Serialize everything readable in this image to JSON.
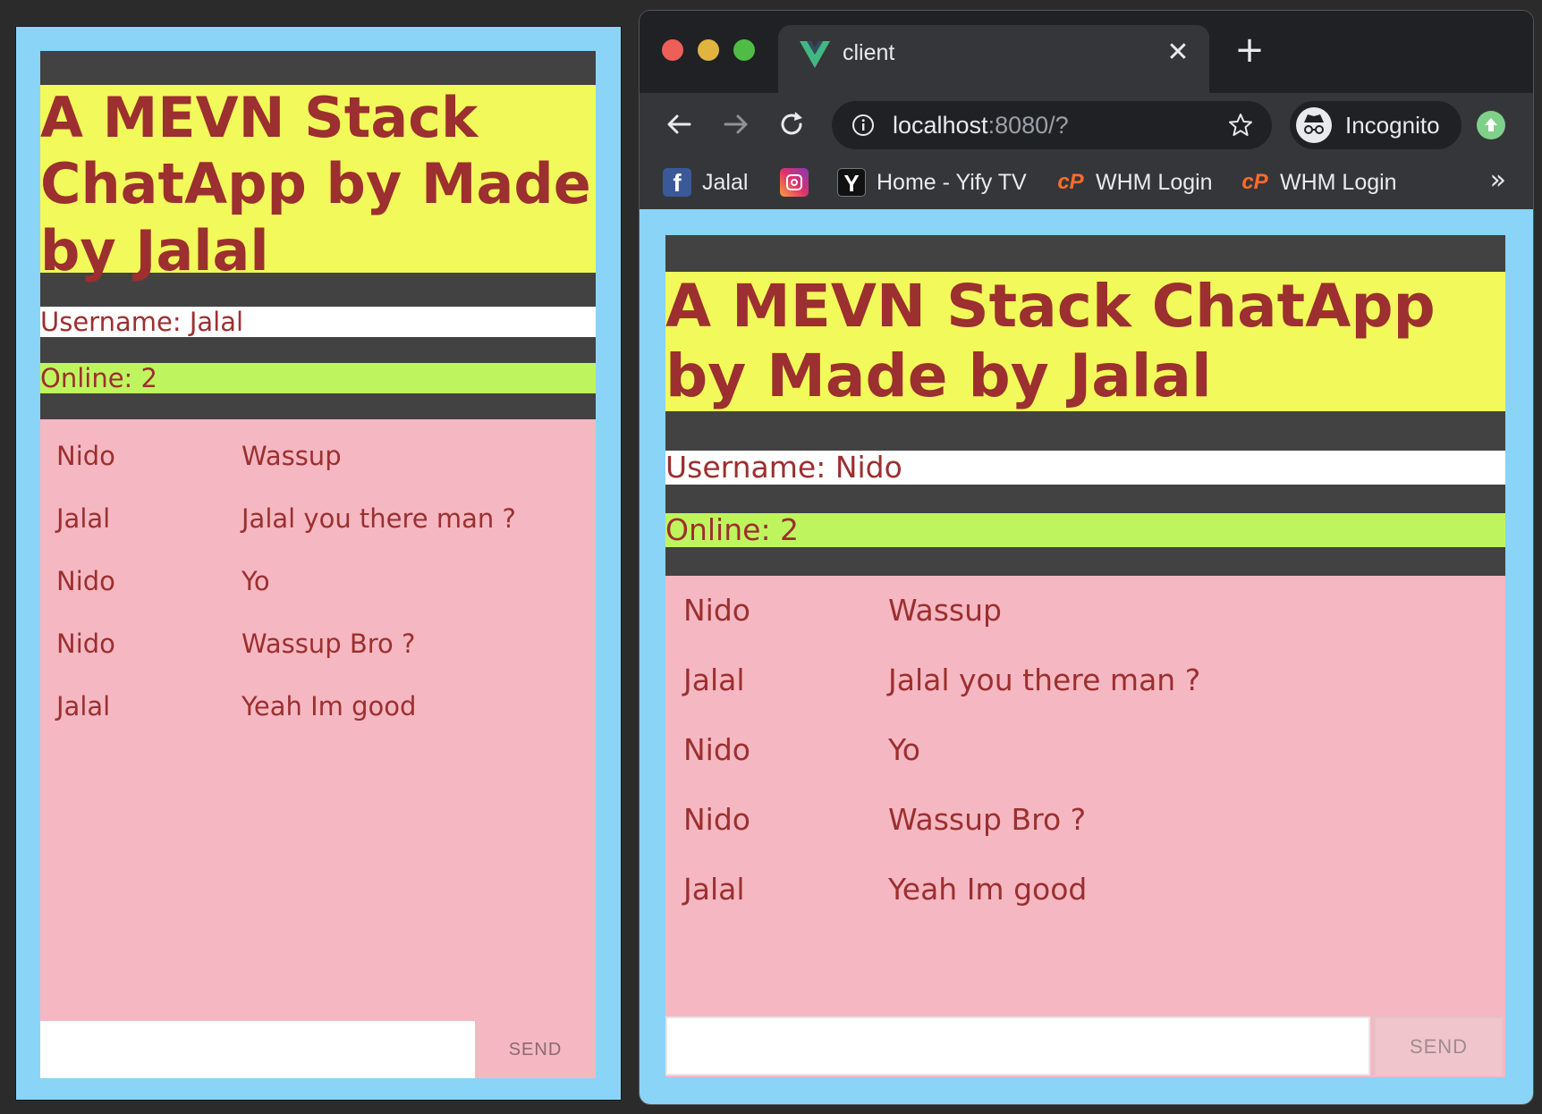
{
  "left_app": {
    "title": "A MEVN Stack ChatApp by Made by Jalal",
    "username_label": "Username: Jalal",
    "online_label": "Online: 2",
    "messages": [
      {
        "user": "Nido",
        "text": "Wassup"
      },
      {
        "user": "Jalal",
        "text": "Jalal you there man ?"
      },
      {
        "user": "Nido",
        "text": "Yo"
      },
      {
        "user": "Nido",
        "text": "Wassup Bro ?"
      },
      {
        "user": "Jalal",
        "text": "Yeah Im good"
      }
    ],
    "input_value": "",
    "send_label": "SEND"
  },
  "browser": {
    "tab_title": "client",
    "tab_icon": "vue-logo-icon",
    "url_host": "localhost",
    "url_rest": ":8080/?",
    "profile_label": "Incognito",
    "bookmarks": [
      {
        "label": "Jalal",
        "icon": "facebook-icon"
      },
      {
        "label": "",
        "icon": "instagram-icon"
      },
      {
        "label": "Home - Yify TV",
        "icon": "yify-icon"
      },
      {
        "label": "WHM Login",
        "icon": "cpanel-icon"
      },
      {
        "label": "WHM Login",
        "icon": "cpanel-icon"
      }
    ],
    "bookmarks_overflow": "»"
  },
  "right_app": {
    "title": "A MEVN Stack ChatApp by Made by Jalal",
    "username_label": "Username: Nido",
    "online_label": "Online: 2",
    "messages": [
      {
        "user": "Nido",
        "text": "Wassup"
      },
      {
        "user": "Jalal",
        "text": "Jalal you there man ?"
      },
      {
        "user": "Nido",
        "text": "Yo"
      },
      {
        "user": "Nido",
        "text": "Wassup Bro ?"
      },
      {
        "user": "Jalal",
        "text": "Yeah Im good"
      }
    ],
    "input_value": "",
    "send_label": "SEND"
  },
  "colors": {
    "page_bg": "#8ad4f7",
    "title_bg": "#f2f95a",
    "text_accent": "#9c2f2f",
    "online_bg": "#bef55e",
    "messages_bg": "#f5b8c2",
    "strip_bg": "#424242"
  }
}
